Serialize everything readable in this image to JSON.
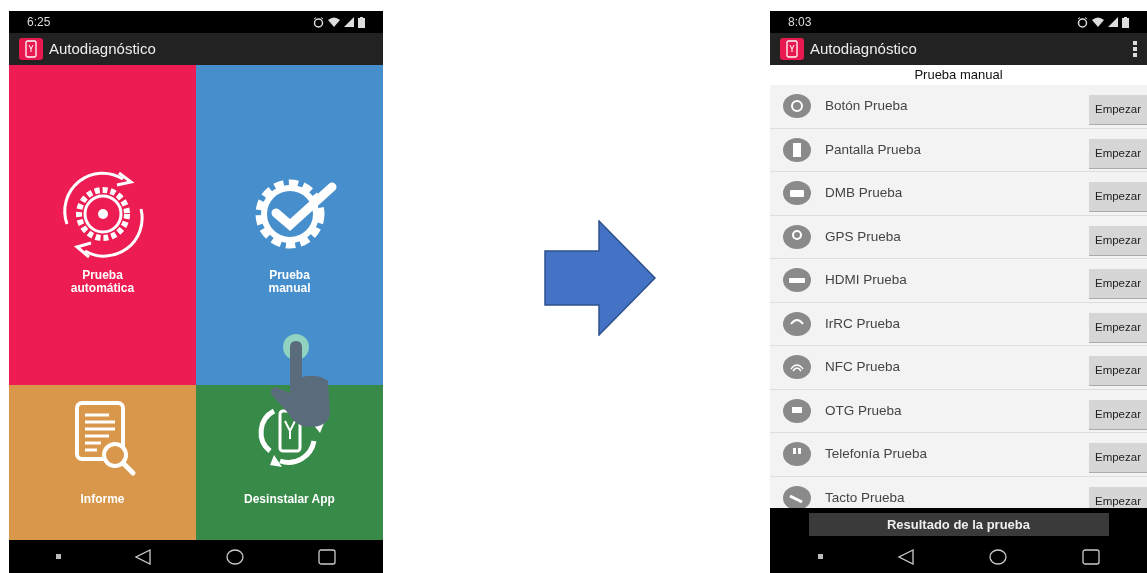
{
  "screens": [
    {
      "status_bar": {
        "time": "6:25"
      },
      "app_bar": {
        "title": "Autodiagnóstico"
      },
      "tiles": [
        {
          "kind": "auto",
          "label": "Prueba\nautomática",
          "color": "#ed1c52"
        },
        {
          "kind": "manual",
          "label": "Prueba\nmanual",
          "color": "#468fcc"
        },
        {
          "kind": "report",
          "label": "Informe",
          "color": "#d8974a"
        },
        {
          "kind": "uninstall",
          "label": "Desinstalar App",
          "color": "#378a48"
        }
      ]
    },
    {
      "status_bar": {
        "time": "8:03"
      },
      "app_bar": {
        "title": "Autodiagnóstico"
      },
      "screen_title": "Prueba manual",
      "tests": [
        {
          "name": "Botón Prueba",
          "button": "Empezar"
        },
        {
          "name": "Pantalla Prueba",
          "button": "Empezar"
        },
        {
          "name": "DMB Prueba",
          "button": "Empezar"
        },
        {
          "name": "GPS Prueba",
          "button": "Empezar"
        },
        {
          "name": "HDMI Prueba",
          "button": "Empezar"
        },
        {
          "name": "IrRC Prueba",
          "button": "Empezar"
        },
        {
          "name": "NFC Prueba",
          "button": "Empezar"
        },
        {
          "name": "OTG Prueba",
          "button": "Empezar"
        },
        {
          "name": "Telefonía Prueba",
          "button": "Empezar"
        },
        {
          "name": "Tacto Prueba",
          "button": "Empezar"
        }
      ],
      "result_button": "Resultado de la prueba"
    }
  ]
}
